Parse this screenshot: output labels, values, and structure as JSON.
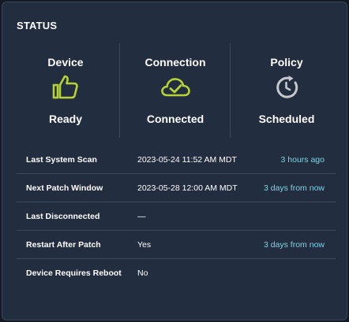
{
  "panel": {
    "title": "STATUS"
  },
  "status": [
    {
      "label": "Device",
      "icon": "thumbs-up-icon",
      "value": "Ready",
      "color": "#b5d334"
    },
    {
      "label": "Connection",
      "icon": "cloud-check-icon",
      "value": "Connected",
      "color": "#b5d334"
    },
    {
      "label": "Policy",
      "icon": "clock-refresh-icon",
      "value": "Scheduled",
      "color": "#c5c9cf"
    }
  ],
  "details": [
    {
      "key": "Last System Scan",
      "value": "2023-05-24 11:52 AM MDT",
      "relative": "3 hours ago"
    },
    {
      "key": "Next Patch Window",
      "value": "2023-05-28 12:00 AM MDT",
      "relative": "3 days from now"
    },
    {
      "key": "Last Disconnected",
      "value": "—",
      "relative": ""
    },
    {
      "key": "Restart After Patch",
      "value": "Yes",
      "relative": "3 days from now"
    },
    {
      "key": "Device Requires Reboot",
      "value": "No",
      "relative": ""
    }
  ],
  "colors": {
    "accent_green": "#b5d334",
    "link_teal": "#7fd4e0",
    "panel_bg": "#222d3f"
  }
}
